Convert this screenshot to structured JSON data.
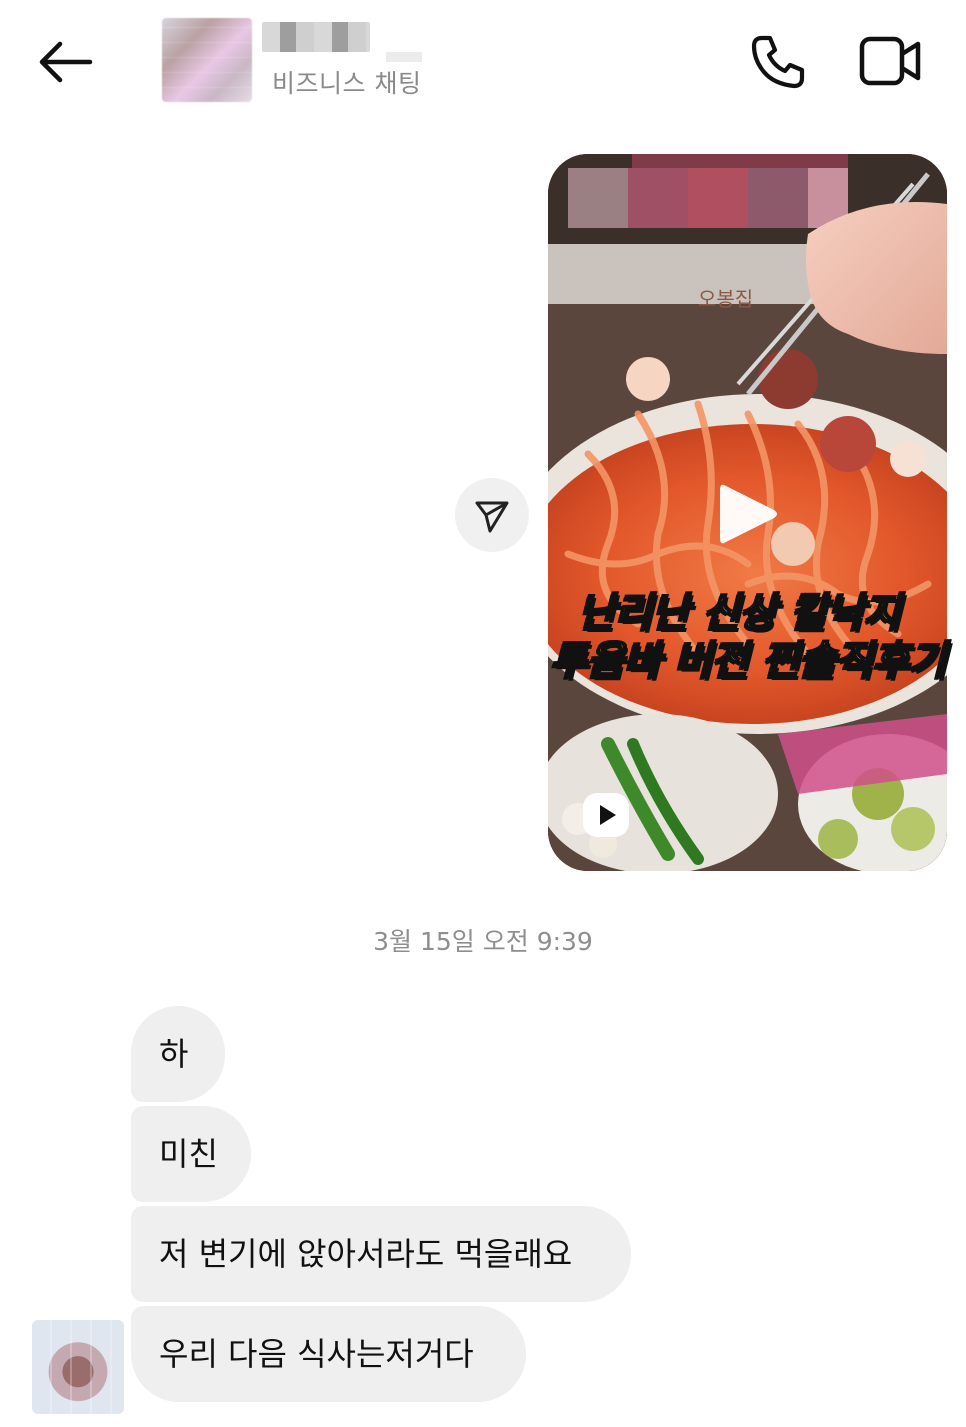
{
  "header": {
    "subtitle": "비즈니스 채팅",
    "back_icon": "arrow-left-icon",
    "call_icon": "phone-icon",
    "video_icon": "video-camera-icon"
  },
  "shared_post": {
    "caption_line1": [
      "난리난 신상 ",
      "칼낙지"
    ],
    "caption_line2": [
      "투움바 버전",
      " 찐솔직후기"
    ],
    "bowl_brand": "오봉집",
    "play_icon": "play-icon",
    "reel_icon": "reels-icon",
    "share_icon": "send-icon"
  },
  "timestamp": "3월 15일 오전 9:39",
  "messages": [
    {
      "text": "하"
    },
    {
      "text": "미친"
    },
    {
      "text": "저 변기에 앉아서라도 먹을래요"
    },
    {
      "text": "우리 다음 식사는저거다"
    }
  ],
  "colors": {
    "bubble": "#efefef",
    "caption_yellow": "#ffea00",
    "sauce": "#e2572b"
  }
}
